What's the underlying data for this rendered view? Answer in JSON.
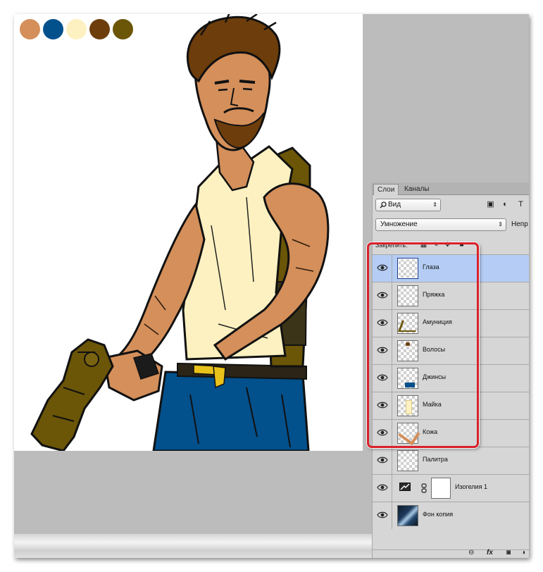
{
  "palette": [
    {
      "color": "#d48f5a"
    },
    {
      "color": "#02508c"
    },
    {
      "color": "#fdf1c1"
    },
    {
      "color": "#6d3d0b"
    },
    {
      "color": "#6b5507"
    }
  ],
  "layers_panel": {
    "tabs": [
      {
        "label": "Слои",
        "active": true
      },
      {
        "label": "Каналы",
        "active": false
      }
    ],
    "filter": {
      "label": "Вид"
    },
    "blend_mode": {
      "value": "Умножение"
    },
    "opacity_label": "Непр",
    "lock_label": "Закрепить:",
    "layers": [
      {
        "name": "Глаза",
        "selected": true,
        "visible": true
      },
      {
        "name": "Пряжка",
        "selected": false,
        "visible": true
      },
      {
        "name": "Амуниция",
        "selected": false,
        "visible": true
      },
      {
        "name": "Волосы",
        "selected": false,
        "visible": true
      },
      {
        "name": "Джинсы",
        "selected": false,
        "visible": true
      },
      {
        "name": "Майка",
        "selected": false,
        "visible": true
      },
      {
        "name": "Кожа",
        "selected": false,
        "visible": true
      },
      {
        "name": "Палитра",
        "selected": false,
        "visible": true
      },
      {
        "name": "Изогелия 1",
        "selected": false,
        "visible": true
      },
      {
        "name": "Фон копия",
        "selected": false,
        "visible": true
      }
    ],
    "footer_icons": [
      "link-icon",
      "fx-icon",
      "mask-icon"
    ],
    "footer_fx_label": "fx"
  },
  "colors": {
    "highlight": "#d9202a",
    "selected_row": "#b5cdf5",
    "workspace": "#bcbcbc",
    "panel": "#d6d6d6"
  }
}
